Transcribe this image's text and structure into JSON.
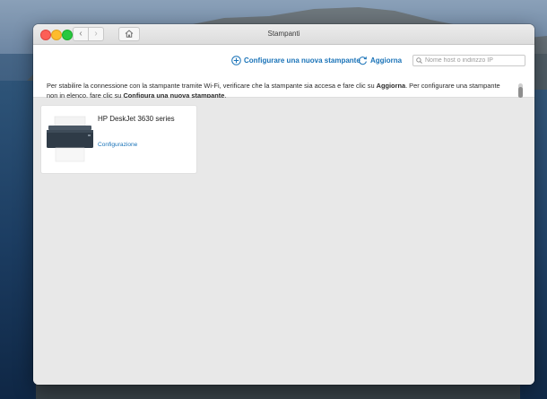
{
  "window": {
    "title": "Stampanti"
  },
  "toolbar": {
    "config_label": "Configurare una nuova stampante",
    "refresh_label": "Aggiorna",
    "search_placeholder": "Nome host o indirizzo IP"
  },
  "info": {
    "part1": "Per stabilire la connessione con la stampante tramite Wi-Fi, verificare che la stampante sia accesa e fare clic su ",
    "bold1": "Aggiorna",
    "part2": ". Per configurare una stampante non in elenco, fare clic su ",
    "bold2": "Configura una nuova stampante",
    "part3": "."
  },
  "printers": [
    {
      "name": "HP DeskJet 3630 series",
      "config_link": "Configurazione"
    }
  ],
  "colors": {
    "accent": "#1a73b8",
    "window_bg": "#e8e8e8"
  }
}
